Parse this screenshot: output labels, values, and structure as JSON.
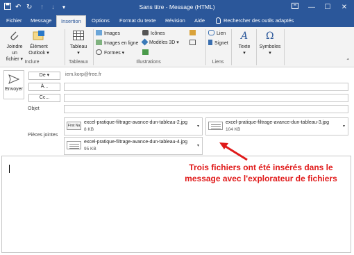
{
  "titlebar": {
    "title": "Sans titre  -  Message (HTML)",
    "icons": [
      "save-icon",
      "undo-icon",
      "redo-icon",
      "up-arrow-icon",
      "down-arrow-icon",
      "customize-icon"
    ],
    "restore_icon": "restore-icon",
    "minimize": "—",
    "maximize": "☐",
    "close": "✕"
  },
  "tabs": [
    "Fichier",
    "Message",
    "Insertion",
    "Options",
    "Format du texte",
    "Révision",
    "Aide",
    "Rechercher des outils adaptés"
  ],
  "active_tab": "Insertion",
  "ribbon": {
    "include": {
      "attach_line1": "Joindre un",
      "attach_line2": "fichier ▾",
      "item_line1": "Élément",
      "item_line2": "Outlook ▾",
      "label": "Inclure"
    },
    "tables": {
      "button": "Tableau",
      "arrow": "▾",
      "label": "Tableaux"
    },
    "illustrations": {
      "images": "Images",
      "images_online": "Images en ligne",
      "shapes": "Formes ▾",
      "icons": "Icônes",
      "models3d": "Modèles 3D ▾",
      "label": "Illustrations"
    },
    "links": {
      "link": "Lien",
      "signet": "Signet",
      "label": "Liens"
    },
    "text": {
      "button": "Texte",
      "arrow": "▾"
    },
    "symbols": {
      "button": "Symboles",
      "arrow": "▾"
    }
  },
  "compose": {
    "send": "Envoyer",
    "from_button": "De ▾",
    "from_value": "iem.korp@free.fr",
    "to_button": "À...",
    "cc_button": "Cc...",
    "subject_label": "Objet",
    "attachments_label": "Pièces jointes",
    "attachments": [
      {
        "name": "excel-pratique-filtrage-avance-dun-tableau-2.jpg",
        "size": "8 KB",
        "thumb": "First Na"
      },
      {
        "name": "excel-pratique-filtrage-avance-dun-tableau-3.jpg",
        "size": "104 KB",
        "thumb": ""
      },
      {
        "name": "excel-pratique-filtrage-avance-dun-tableau-4.jpg",
        "size": "95 KB",
        "thumb": ""
      }
    ],
    "dropdown_glyph": "▾"
  },
  "annotation": {
    "line1": "Trois fichiers ont été insérés dans le",
    "line2": "message avec l'explorateur de fichiers",
    "color": "#e01a1a"
  },
  "colors": {
    "brand": "#2b579a",
    "ribbon_bg": "#f3f3f3",
    "annotation": "#e01a1a"
  }
}
